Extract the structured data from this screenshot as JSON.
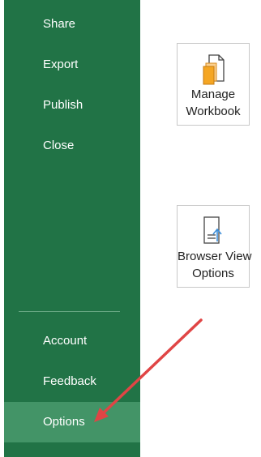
{
  "sidebar": {
    "items_top": [
      {
        "label": "Share"
      },
      {
        "label": "Export"
      },
      {
        "label": "Publish"
      },
      {
        "label": "Close"
      }
    ],
    "items_bottom": [
      {
        "label": "Account"
      },
      {
        "label": "Feedback"
      },
      {
        "label": "Options",
        "selected": true
      }
    ]
  },
  "tiles": {
    "manage_workbook": {
      "line1": "Manage",
      "line2": "Workbook",
      "icon": "manage-workbook-icon"
    },
    "browser_view": {
      "line1": "Browser View",
      "line2": "Options",
      "icon": "browser-view-options-icon"
    }
  },
  "annotation": {
    "color": "#e04545",
    "icon": "red-arrow"
  },
  "colors": {
    "sidebar": "#217346",
    "selected": "#439467",
    "accent_orange": "#f5a623"
  }
}
